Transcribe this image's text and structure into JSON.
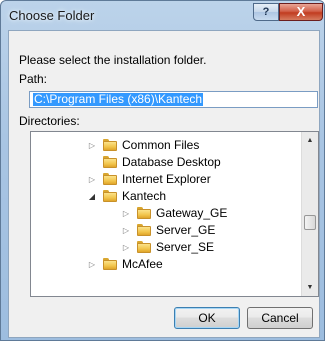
{
  "window": {
    "title": "Choose Folder",
    "help_label": "?",
    "close_label": "X"
  },
  "dialog": {
    "instruction": "Please select the installation folder.",
    "path_label": "Path:",
    "path_value": "C:\\Program Files (x86)\\Kantech",
    "directories_label": "Directories:"
  },
  "tree": {
    "items": [
      {
        "label": "Common Files",
        "level": 0,
        "expander": "collapsed"
      },
      {
        "label": "Database Desktop",
        "level": 0,
        "expander": "none"
      },
      {
        "label": "Internet Explorer",
        "level": 0,
        "expander": "collapsed"
      },
      {
        "label": "Kantech",
        "level": 0,
        "expander": "expanded"
      },
      {
        "label": "Gateway_GE",
        "level": 1,
        "expander": "collapsed"
      },
      {
        "label": "Server_GE",
        "level": 1,
        "expander": "collapsed"
      },
      {
        "label": "Server_SE",
        "level": 1,
        "expander": "collapsed"
      },
      {
        "label": "McAfee",
        "level": 0,
        "expander": "collapsed"
      }
    ]
  },
  "buttons": {
    "ok_label": "OK",
    "cancel_label": "Cancel"
  }
}
